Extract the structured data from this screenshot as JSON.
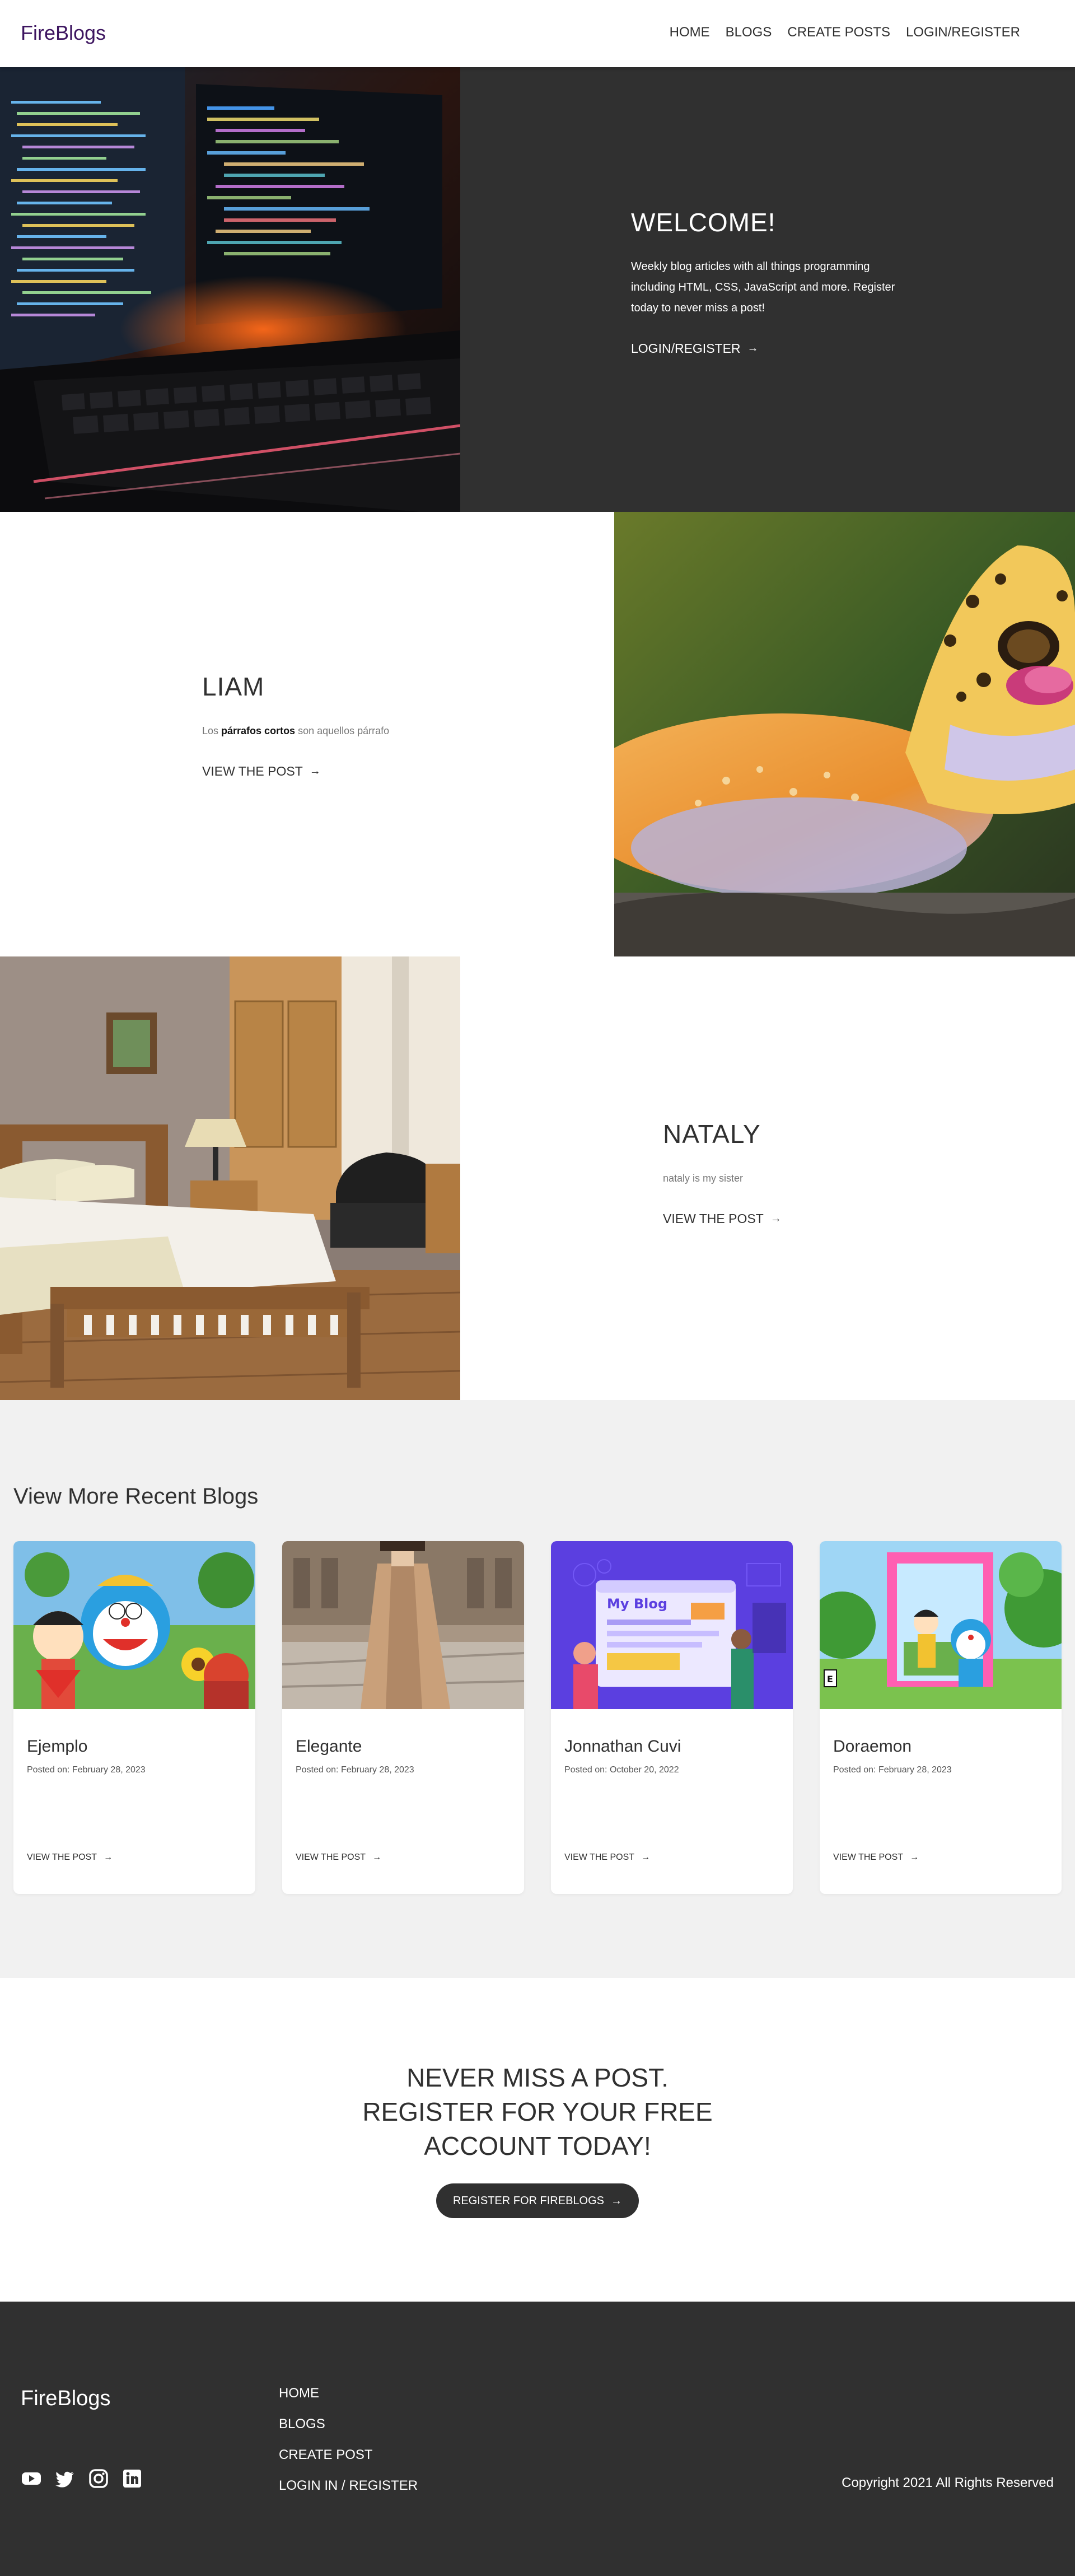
{
  "nav": {
    "logo": "FireBlogs",
    "links": [
      "HOME",
      "BLOGS",
      "CREATE POSTS",
      "LOGIN/REGISTER"
    ]
  },
  "welcome": {
    "title": "WELCOME!",
    "description": "Weekly blog articles with all things programming including HTML, CSS, JavaScript and more. Register today to never miss a post!",
    "link": "LOGIN/REGISTER"
  },
  "posts": [
    {
      "title": "LIAM",
      "excerpt_prefix": "Los ",
      "excerpt_bold": "párrafos cortos",
      "excerpt_suffix": " son aquellos párrafo",
      "link": "VIEW THE POST"
    },
    {
      "title": "NATALY",
      "excerpt": "nataly is my sister",
      "link": "VIEW THE POST"
    }
  ],
  "recent": {
    "title": "View More Recent Blogs",
    "cards": [
      {
        "title": "Ejemplo",
        "date": "Posted on: February 28, 2023",
        "link": "VIEW THE POST"
      },
      {
        "title": "Elegante",
        "date": "Posted on: February 28, 2023",
        "link": "VIEW THE POST"
      },
      {
        "title": "Jonnathan Cuvi",
        "date": "Posted on: October 20, 2022",
        "link": "VIEW THE POST",
        "image_text": "My Blog"
      },
      {
        "title": "Doraemon",
        "date": "Posted on: February 28, 2023",
        "link": "VIEW THE POST"
      }
    ]
  },
  "cta": {
    "line1": "NEVER MISS A POST.",
    "line2": "REGISTER FOR YOUR FREE",
    "line3": "ACCOUNT TODAY!",
    "button": "REGISTER FOR FIREBLOGS"
  },
  "footer": {
    "logo": "FireBlogs",
    "social_icons": [
      "youtube-icon",
      "twitter-icon",
      "instagram-icon",
      "linkedin-icon"
    ],
    "links": [
      "HOME",
      "BLOGS",
      "CREATE POST",
      "LOGIN IN / REGISTER"
    ],
    "copyright": "Copyright 2021 All Rights Reserved"
  },
  "colors": {
    "brand": "#3d1560",
    "dark": "#303030",
    "light_bg": "#f1f1f1"
  }
}
